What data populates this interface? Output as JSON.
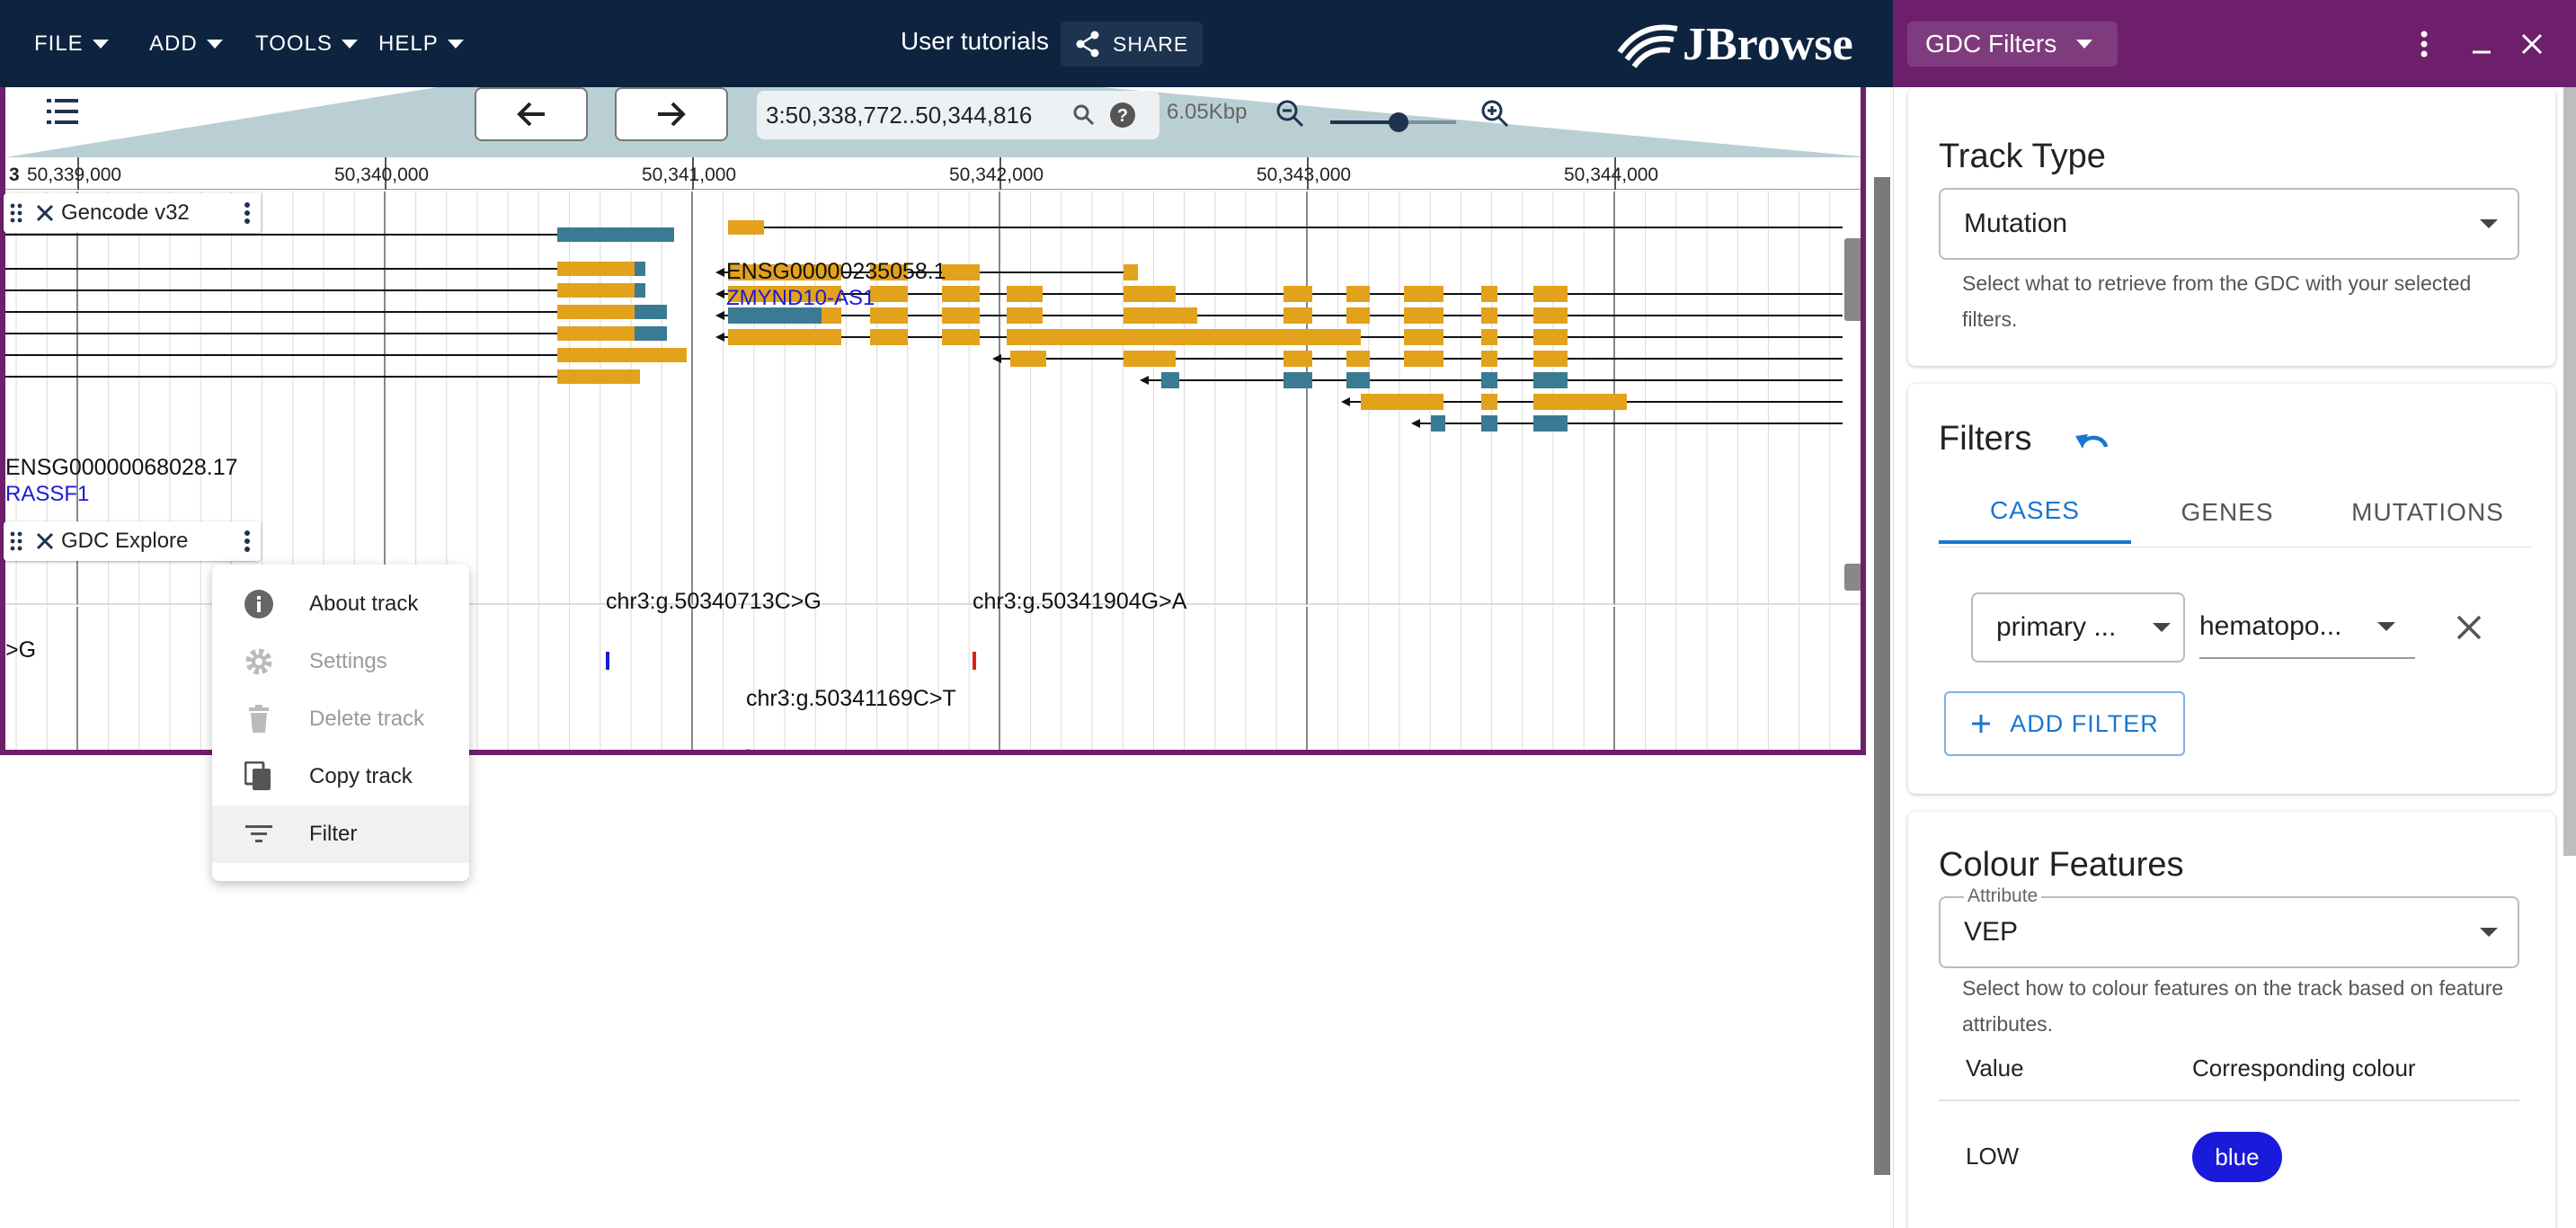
{
  "menubar": {
    "items": [
      {
        "label": "FILE"
      },
      {
        "label": "ADD"
      },
      {
        "label": "TOOLS"
      },
      {
        "label": "HELP"
      }
    ],
    "session_title": "User tutorials",
    "share_label": "SHARE",
    "logo_text": "JBrowse"
  },
  "drawer_header": {
    "widget_name": "GDC Filters"
  },
  "navigation": {
    "locstring": "3:50,338,772..50,344,816",
    "bp_count": "6.05Kbp",
    "zoom_level": 0.55,
    "ruler": {
      "chrom": "3",
      "ticks": [
        "50,339,000",
        "50,340,000",
        "50,341,000",
        "50,342,000",
        "50,343,000",
        "50,344,000"
      ]
    }
  },
  "tracks": {
    "gencode": {
      "label": "Gencode v32",
      "genes": [
        {
          "name": "ENSG00000235058.1",
          "description": "ZMYND10-AS1"
        },
        {
          "name": "ENSG00000068028.17",
          "description": "RASSF1"
        }
      ]
    },
    "gdc": {
      "label": "GDC Explore",
      "mutations": [
        {
          "label": "chr3:g.50340713C>G",
          "color": "#1b1bd6"
        },
        {
          "label": "chr3:g.50341904G>A",
          "color": "#e0201a"
        },
        {
          "label": "chr3:g.50341169C>T",
          "color": "#e2a21c"
        },
        {
          "label": ">G"
        }
      ]
    }
  },
  "track_menu": {
    "items": [
      {
        "label": "About track",
        "icon": "info-icon",
        "disabled": false
      },
      {
        "label": "Settings",
        "icon": "gear-icon",
        "disabled": true
      },
      {
        "label": "Delete track",
        "icon": "trash-icon",
        "disabled": true
      },
      {
        "label": "Copy track",
        "icon": "copy-icon",
        "disabled": false
      },
      {
        "label": "Filter",
        "icon": "filter-icon",
        "disabled": false
      }
    ]
  },
  "gdc_filters": {
    "track_type": {
      "title": "Track Type",
      "value": "Mutation",
      "helper": "Select what to retrieve from the GDC with your selected filters."
    },
    "filters": {
      "title": "Filters",
      "tabs": [
        "CASES",
        "GENES",
        "MUTATIONS"
      ],
      "active_tab": "CASES",
      "filter_row": {
        "category": "primary ...",
        "value": "hematopo..."
      },
      "add_filter_label": "ADD FILTER"
    },
    "colour_features": {
      "title": "Colour Features",
      "attribute_label": "Attribute",
      "attribute_value": "VEP",
      "helper": "Select how to colour features on the track based on feature attributes.",
      "table_headers": [
        "Value",
        "Corresponding colour"
      ],
      "rows": [
        {
          "value": "LOW",
          "colour": "blue"
        }
      ]
    }
  },
  "colors": {
    "appbar": "#0d233f",
    "drawer_header": "#6d1f6b",
    "utr": "#e2a21c",
    "cds": "#3a7a92",
    "primary": "#1976d2"
  }
}
